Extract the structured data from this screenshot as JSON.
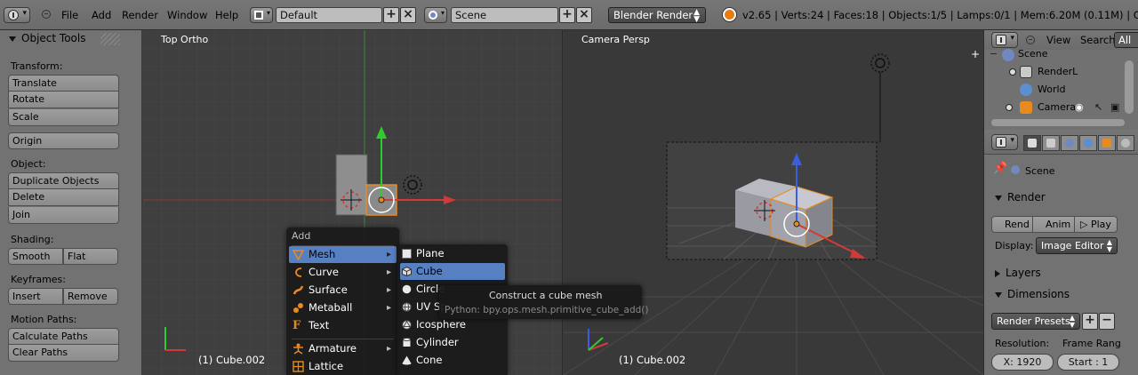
{
  "header": {
    "menu": [
      "File",
      "Add",
      "Render",
      "Window",
      "Help"
    ],
    "layout": "Default",
    "scene": "Scene",
    "render_engine": "Blender Render",
    "stats": "v2.65 | Verts:24 | Faces:18 | Objects:1/5 | Lamps:0/1 | Mem:6.20M (0.11M) | Cube.002"
  },
  "tool_shelf": {
    "title": "Object Tools",
    "transform_label": "Transform:",
    "translate": "Translate",
    "rotate": "Rotate",
    "scale": "Scale",
    "origin": "Origin",
    "object_label": "Object:",
    "duplicate": "Duplicate Objects",
    "delete": "Delete",
    "join": "Join",
    "shading_label": "Shading:",
    "smooth": "Smooth",
    "flat": "Flat",
    "keyframes_label": "Keyframes:",
    "insert": "Insert",
    "remove": "Remove",
    "motion_label": "Motion Paths:",
    "calc_paths": "Calculate Paths",
    "clear_paths": "Clear Paths"
  },
  "viewport_left": {
    "label": "Top Ortho",
    "status": "(1) Cube.002"
  },
  "viewport_right": {
    "label": "Camera Persp",
    "status": "(1) Cube.002"
  },
  "add_menu": {
    "title": "Add",
    "items": [
      "Mesh",
      "Curve",
      "Surface",
      "Metaball",
      "Text",
      "Armature",
      "Lattice"
    ]
  },
  "mesh_menu": {
    "items": [
      "Plane",
      "Cube",
      "Circle",
      "UV Sp",
      "Icosphere",
      "Cylinder",
      "Cone"
    ]
  },
  "tooltip": {
    "title": "Construct a cube mesh",
    "python": "Python: bpy.ops.mesh.primitive_cube_add()"
  },
  "outliner": {
    "view": "View",
    "search": "Search",
    "all": "All",
    "rows": [
      "Scene",
      "RenderL",
      "World",
      "Camera"
    ]
  },
  "properties": {
    "context": "Scene",
    "render_panel": "Render",
    "render_btn": "Rend",
    "anim_btn": "Anim",
    "play_btn": "Play",
    "display_label": "Display:",
    "display_value": "Image Editor",
    "layers_panel": "Layers",
    "dimensions_panel": "Dimensions",
    "presets": "Render Presets",
    "resolution_label": "Resolution:",
    "frame_label": "Frame Rang",
    "res_x": "X: 1920",
    "start": "Start : 1"
  }
}
